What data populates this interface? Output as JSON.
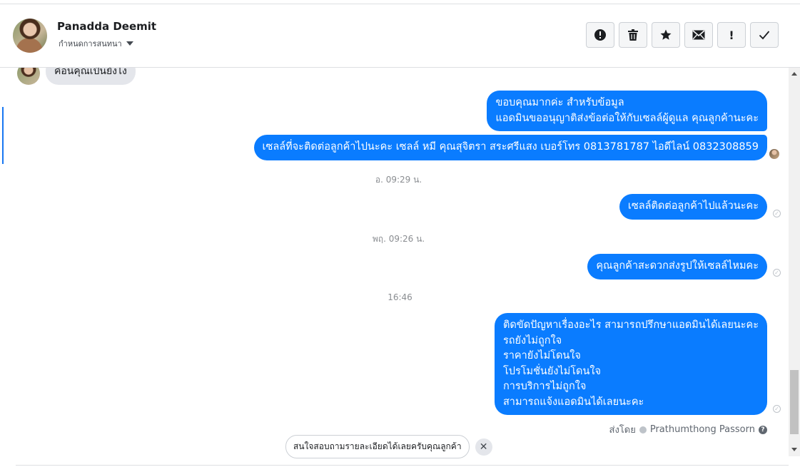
{
  "header": {
    "contact_name": "Panadda Deemit",
    "subtitle": "กำหนดการสนทนา",
    "toolbar": [
      {
        "name": "alert-circle-button",
        "icon": "alert-circle-icon"
      },
      {
        "name": "delete-button",
        "icon": "trash-icon"
      },
      {
        "name": "star-button",
        "icon": "star-icon"
      },
      {
        "name": "mark-unread-button",
        "icon": "envelope-icon"
      },
      {
        "name": "important-button",
        "icon": "exclamation-icon",
        "glyph": "!"
      },
      {
        "name": "done-button",
        "icon": "checkmark-icon"
      }
    ]
  },
  "messages": {
    "incoming_partial": "คือนี่คุณเป็นยังไง",
    "m1": [
      "ขอบคุณมากค่ะ สำหรับข้อมูล",
      "แอดมินขออนุญาติส่งข้อต่อให้กับเซลล์ผู้ดูแล คุณลูกค้านะคะ"
    ],
    "m2": "เซลล์ที่จะติดต่อลูกค้าไปนะคะ เซลล์ หมี คุณสุจิตรา สระศรีแสง เบอร์โทร 0813781787 ไอดีไลน์ 0832308859",
    "ts1": "อ. 09:29 น.",
    "m3": "เซลล์ติดต่อลูกค้าไปแล้วนะคะ",
    "ts2": "พฤ. 09:26 น.",
    "m4": "คุณลูกค้าสะดวกส่งรูปให้เซลล์ไหมคะ",
    "ts3": "16:46",
    "m5": [
      "ติดขัดปัญหาเรื่องอะไร สามารถปรึกษาแอดมินได้เลยนะคะ",
      "รถยังไม่ถูกใจ",
      "ราคายังไม่โดนใจ",
      "โปรโมชั่นยังไม่โดนใจ",
      "การบริการไม่ถูกใจ",
      "สามารถแจ้งแอดมินได้เลยนะคะ"
    ],
    "sent_by_label": "ส่งโดย",
    "sent_by_name": "Prathumthong Passorn"
  },
  "suggestion": {
    "chip": "สนใจสอบถามรายละเอียดได้เลยครับคุณลูกค้า",
    "close": "✕"
  },
  "colors": {
    "outgoing_bubble": "#0a7cff",
    "incoming_bubble": "#e4e6eb",
    "accent": "#1877f2"
  }
}
